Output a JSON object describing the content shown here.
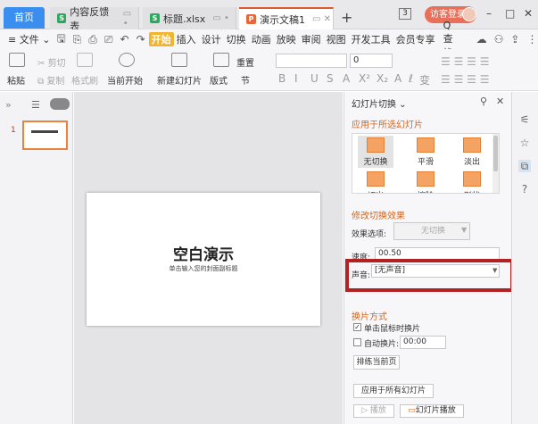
{
  "tabs": {
    "home": "首页",
    "doc1": {
      "name": "内容反馈表",
      "icon": "S"
    },
    "doc2": {
      "name": "标题.xlsx",
      "icon": "S"
    },
    "doc3": {
      "name": "演示文稿1",
      "icon": "P"
    },
    "add": "+"
  },
  "window": {
    "badge": "3",
    "login": "访客登录",
    "minimize": "–",
    "maximize": "□",
    "close": "✕"
  },
  "menu": {
    "file": "≡ 文件 ⌄",
    "items": [
      "开始",
      "插入",
      "设计",
      "切换",
      "动画",
      "放映",
      "审阅",
      "视图",
      "开发工具",
      "会员专享"
    ],
    "search": "Q查找"
  },
  "ribbon": {
    "paste": "粘贴",
    "cut": "剪切",
    "copy": "复制",
    "format_painter": "格式刷",
    "play_from_current": "当前开始",
    "new_slide": "新建幻灯片",
    "layout": "版式",
    "section": "节",
    "reset": "重置",
    "font_size": "0",
    "format_buttons": [
      "B",
      "I",
      "U",
      "S",
      "A",
      "X²",
      "X₂",
      "A",
      "ℓ",
      "变"
    ]
  },
  "thumbnails": [
    {
      "num": "1"
    }
  ],
  "slide": {
    "title": "空白演示",
    "subtitle": "单击输入您的封面副标题"
  },
  "pane": {
    "title": "幻灯片切换 ⌄",
    "apply_section": "应用于所选幻灯片",
    "transitions": [
      {
        "label": "无切换",
        "selected": true
      },
      {
        "label": "平滑",
        "selected": false
      },
      {
        "label": "淡出",
        "selected": false
      },
      {
        "label": "切出",
        "selected": false
      },
      {
        "label": "擦除",
        "selected": false
      },
      {
        "label": "形状",
        "selected": false
      }
    ],
    "modify_section": "修改切换效果",
    "effect_options_label": "效果选项:",
    "effect_options_value": "无切换",
    "speed_label": "速度:",
    "speed_value": "00.50",
    "sound_label": "声音:",
    "sound_value": "[无声音]",
    "advance_section": "换片方式",
    "on_click_label": "单击鼠标时换片",
    "on_click_checked": true,
    "auto_label": "自动换片:",
    "auto_value": "00:00",
    "auto_checked": false,
    "rehearse": "排练当前页",
    "apply_all": "应用于所有幻灯片",
    "play": "▷ 播放",
    "slideshow": "幻灯片播放"
  },
  "colors": {
    "accent": "#d3651f",
    "highlight_border": "#b22222",
    "home_tab": "#3a8ef0"
  }
}
